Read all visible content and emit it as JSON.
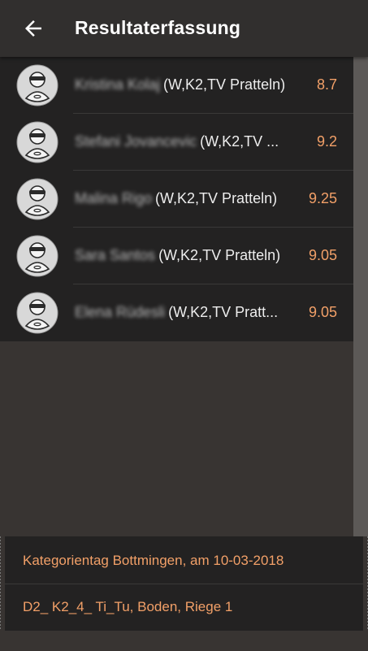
{
  "header": {
    "title": "Resultaterfassung"
  },
  "entries": [
    {
      "name": "Kristina Kolaj",
      "details": "(W,K2,TV Pratteln)",
      "score": "8.7"
    },
    {
      "name": "Stefani Jovancevic",
      "details": "(W,K2,TV ...",
      "score": "9.2"
    },
    {
      "name": "Malina Rigo",
      "details": "(W,K2,TV Pratteln)",
      "score": "9.25"
    },
    {
      "name": "Sara Santos",
      "details": "(W,K2,TV Pratteln)",
      "score": "9.05"
    },
    {
      "name": "Elena Rüdesli",
      "details": "(W,K2,TV Pratt...",
      "score": "9.05"
    }
  ],
  "footer": {
    "competition": "Kategorientag Bottmingen, am 10-03-2018",
    "group": "D2_ K2_4_ Ti_Tu, Boden, Riege 1"
  },
  "colors": {
    "accent": "#f2a068",
    "appbar": "#312f2e",
    "list_bg": "#232222"
  }
}
